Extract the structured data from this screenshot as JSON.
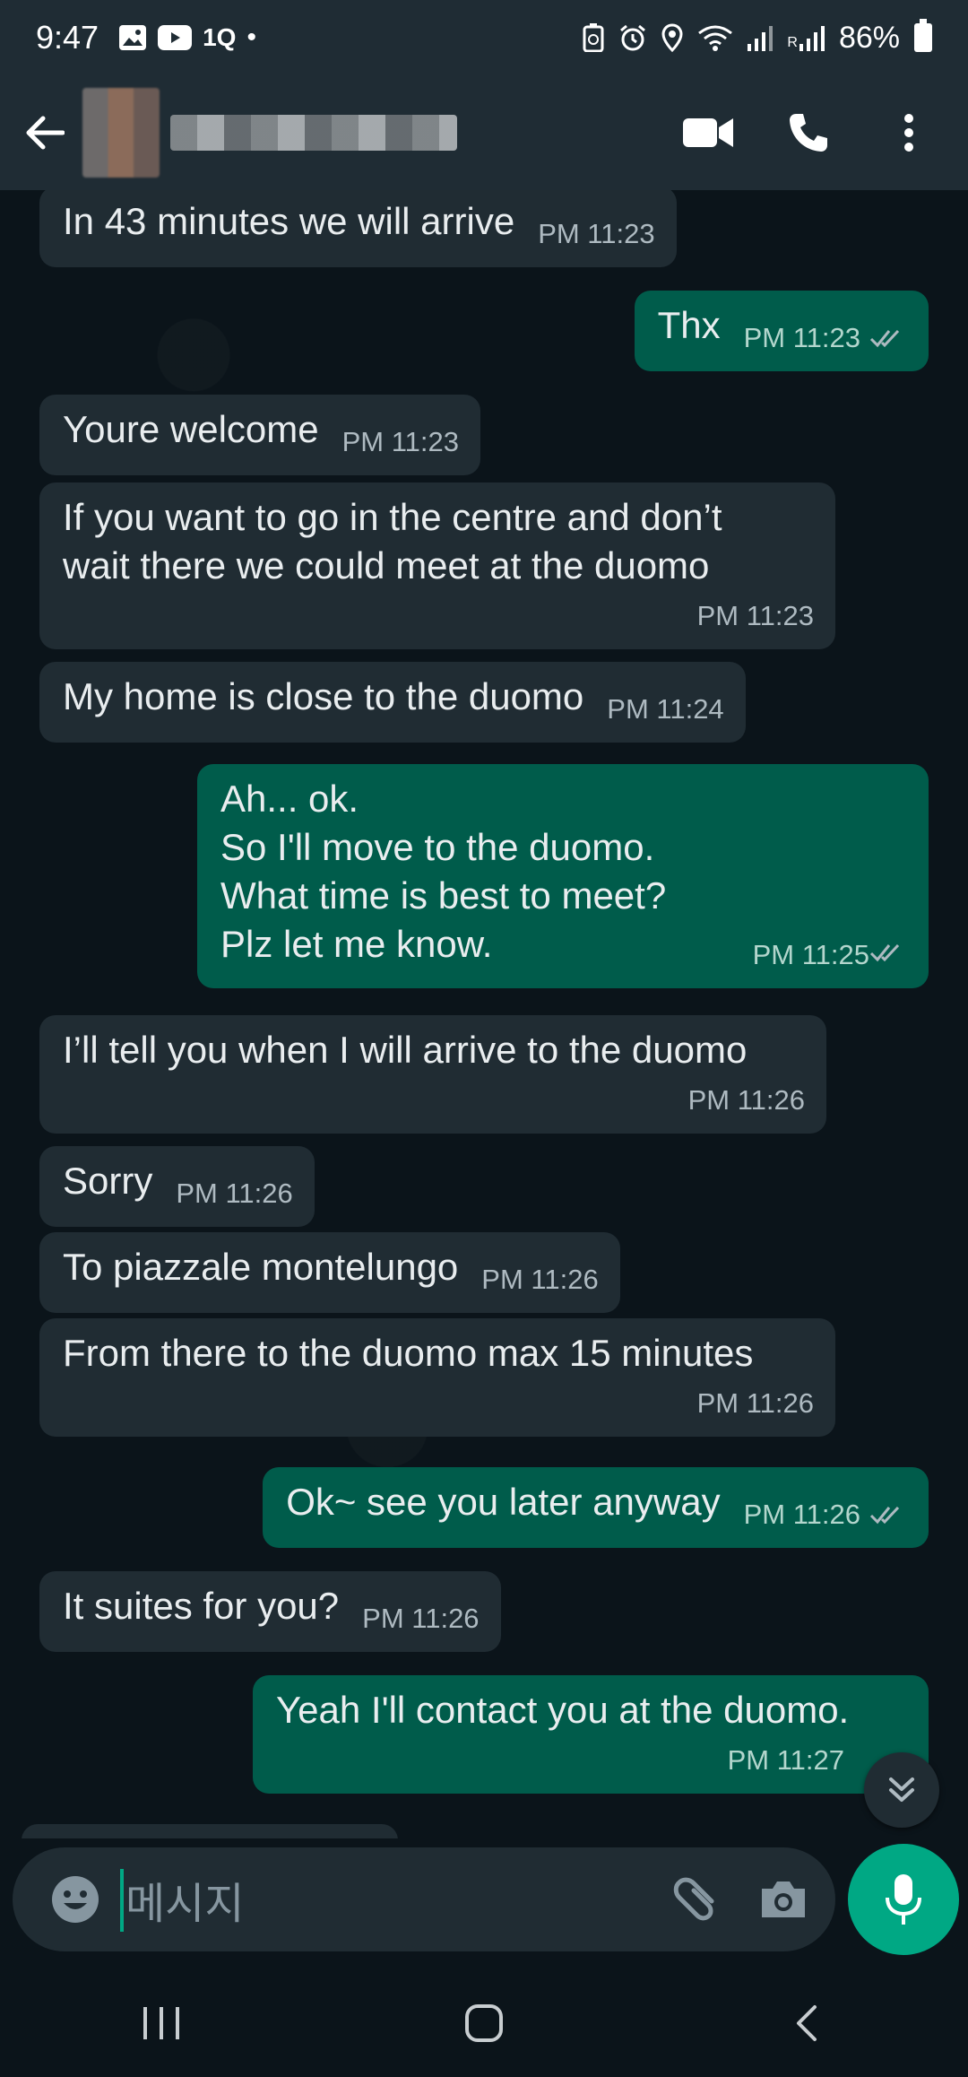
{
  "status_bar": {
    "time": "9:47",
    "battery": "86%",
    "left_icons": [
      "gallery-icon",
      "youtube-icon",
      "1q-icon",
      "dot-icon"
    ],
    "right_icons": [
      "battery-saver-icon",
      "alarm-icon",
      "location-icon",
      "wifi-icon",
      "signal-icon",
      "signal-r-icon",
      "battery-icon"
    ],
    "left_text": "1Q",
    "r_label": "R"
  },
  "header": {
    "contact_name": "",
    "actions": [
      "video-call-icon",
      "voice-call-icon",
      "more-options-icon"
    ]
  },
  "colors": {
    "background": "#0b141a",
    "bar": "#1f2c34",
    "incoming_bubble": "#202c33",
    "outgoing_bubble": "#005c4b",
    "accent": "#00a884"
  },
  "messages": [
    {
      "dir": "in",
      "text": "In 43 minutes we will arrive",
      "time": "PM 11:23"
    },
    {
      "dir": "out",
      "text": "Thx",
      "time": "PM 11:23",
      "read": true
    },
    {
      "dir": "in",
      "text": "Youre welcome",
      "time": "PM 11:23"
    },
    {
      "dir": "in",
      "text": "If you want to go in the centre and don’t\nwait there we could meet at the duomo",
      "time": "PM 11:23"
    },
    {
      "dir": "in",
      "text": "My home is close to the duomo",
      "time": "PM 11:24"
    },
    {
      "dir": "out",
      "text": "Ah... ok.\nSo I'll move to the duomo.\nWhat time is best to meet?\nPlz let me know.",
      "time": "PM 11:25",
      "read": true
    },
    {
      "dir": "in",
      "text": "I’ll tell you when I will arrive to the duomo",
      "time": "PM 11:26"
    },
    {
      "dir": "in",
      "text": "Sorry",
      "time": "PM 11:26"
    },
    {
      "dir": "in",
      "text": "To piazzale montelungo",
      "time": "PM 11:26"
    },
    {
      "dir": "in",
      "text": "From there to the duomo max 15 minutes",
      "time": "PM 11:26"
    },
    {
      "dir": "out",
      "text": "Ok~ see you later anyway",
      "time": "PM 11:26",
      "read": true
    },
    {
      "dir": "in",
      "text": "It suites for you?",
      "time": "PM 11:26"
    },
    {
      "dir": "out",
      "text": "Yeah I'll contact you at the duomo.",
      "time": "PM 11:27",
      "read": false
    }
  ],
  "composer": {
    "placeholder": "메시지"
  }
}
